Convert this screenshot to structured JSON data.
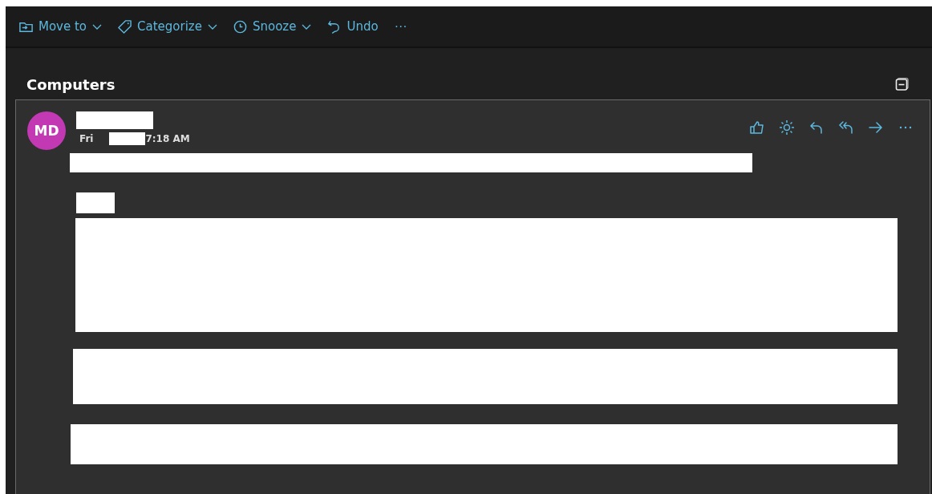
{
  "toolbar": {
    "items": [
      {
        "label": "Move to",
        "kind": "move",
        "dropdown": true
      },
      {
        "label": "Categorize",
        "kind": "tag",
        "dropdown": true
      },
      {
        "label": "Snooze",
        "kind": "clock",
        "dropdown": true
      },
      {
        "label": "Undo",
        "kind": "undo",
        "dropdown": false
      }
    ],
    "more": "···"
  },
  "conversation": {
    "title": "Computers"
  },
  "message": {
    "avatar_initials": "MD",
    "date_prefix": "Fri",
    "time": "7:18 AM",
    "actions": [
      {
        "kind": "like"
      },
      {
        "kind": "sun"
      },
      {
        "kind": "reply"
      },
      {
        "kind": "reply-all"
      },
      {
        "kind": "forward"
      },
      {
        "kind": "more"
      }
    ]
  }
}
